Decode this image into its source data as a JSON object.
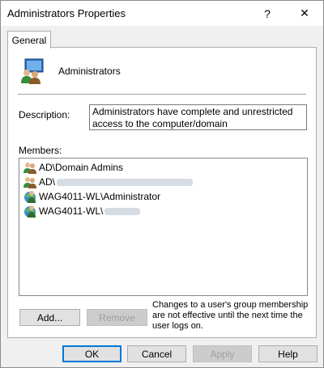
{
  "window": {
    "title": "Administrators Properties",
    "help_glyph": "?",
    "close_glyph": "✕"
  },
  "tabs": [
    {
      "label": "General"
    }
  ],
  "group": {
    "name": "Administrators",
    "icon": "users-group-icon"
  },
  "description": {
    "label": "Description:",
    "value": "Administrators have complete and unrestricted access to the computer/domain"
  },
  "members": {
    "label": "Members:",
    "items": [
      {
        "prefix": "AD\\Domain Admins",
        "icon": "group-icon",
        "redacted": false
      },
      {
        "prefix": "AD\\",
        "icon": "group-icon",
        "redacted": true
      },
      {
        "prefix": "WAG4011-WL\\Administrator",
        "icon": "user-icon",
        "redacted": false
      },
      {
        "prefix": "WAG4011-WL\\",
        "icon": "user-icon",
        "redacted": true
      }
    ]
  },
  "buttons": {
    "add": "Add...",
    "remove": "Remove",
    "ok": "OK",
    "cancel": "Cancel",
    "apply": "Apply",
    "help": "Help"
  },
  "note": "Changes to a user's group membership are not effective until the next time the user logs on.",
  "colors": {
    "accent": "#0078d7",
    "dialog_bg": "#f0f0f0",
    "disabled_text": "#9e9e9e"
  }
}
